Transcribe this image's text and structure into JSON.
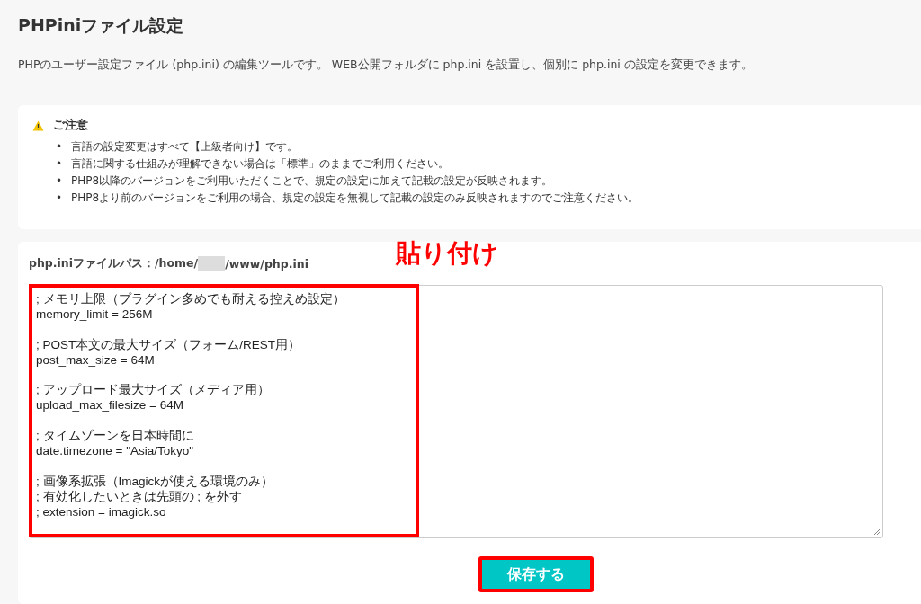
{
  "page": {
    "title": "PHPiniファイル設定",
    "description": "PHPのユーザー設定ファイル (php.ini) の編集ツールです。 WEB公開フォルダに php.ini を設置し、個別に php.ini の設定を変更できます。"
  },
  "notice": {
    "title": "ご注意",
    "items": [
      {
        "bullet": "•",
        "text": "言語の設定変更はすべて【上級者向け】です。"
      },
      {
        "bullet": "•",
        "text": "言語に関する仕組みが理解できない場合は「標準」のままでご利用ください。"
      },
      {
        "bullet": "•",
        "text": "PHP8以降のバージョンをご利用いただくことで、規定の設定に加えて記載の設定が反映されます。"
      },
      {
        "bullet": "•",
        "text": "PHP8より前のバージョンをご利用の場合、規定の設定を無視して記載の設定のみ反映されますのでご注意ください。"
      }
    ]
  },
  "editor": {
    "path_prefix": "php.iniファイルパス：/home/",
    "path_suffix": "/www/php.ini",
    "blocks": [
      [
        "; メモリ上限（プラグイン多めでも耐える控えめ設定）",
        "memory_limit = 256M"
      ],
      [
        "; POST本文の最大サイズ（フォーム/REST用）",
        "post_max_size = 64M"
      ],
      [
        "; アップロード最大サイズ（メディア用）",
        "upload_max_filesize = 64M"
      ],
      [
        "; タイムゾーンを日本時間に",
        "date.timezone = \"Asia/Tokyo\""
      ],
      [
        "; 画像系拡張（Imagickが使える環境のみ）",
        "; 有効化したいときは先頭の ; を外す",
        "; extension = imagick.so"
      ]
    ],
    "save_button": "保存する"
  },
  "annotation": {
    "label": "貼り付け"
  }
}
